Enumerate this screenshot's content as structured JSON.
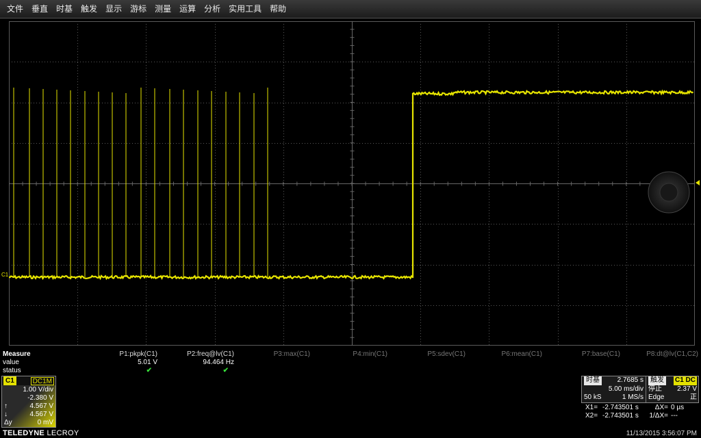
{
  "menu": [
    "文件",
    "垂直",
    "时基",
    "触发",
    "显示",
    "游标",
    "测量",
    "运算",
    "分析",
    "实用工具",
    "帮助"
  ],
  "channel_marker": "C1",
  "measure": {
    "title": "Measure",
    "row_value": "value",
    "row_status": "status",
    "params": [
      {
        "name": "P1:pkpk(C1)",
        "value": "5.01 V",
        "status": "✔",
        "active": true
      },
      {
        "name": "P2:freq@lv(C1)",
        "value": "94.464 Hz",
        "status": "✔",
        "active": true
      },
      {
        "name": "P3:max(C1)",
        "value": "",
        "status": "",
        "active": false
      },
      {
        "name": "P4:min(C1)",
        "value": "",
        "status": "",
        "active": false
      },
      {
        "name": "P5:sdev(C1)",
        "value": "",
        "status": "",
        "active": false
      },
      {
        "name": "P6:mean(C1)",
        "value": "",
        "status": "",
        "active": false
      },
      {
        "name": "P7:base(C1)",
        "value": "",
        "status": "",
        "active": false
      },
      {
        "name": "P8:dt@lv(C1,C2)",
        "value": "",
        "status": "",
        "active": false
      }
    ]
  },
  "c1": {
    "tag": "C1",
    "coupling": "DC1M",
    "vdiv": "1.00 V/div",
    "offset": "-2.380 V",
    "up_label": "↑",
    "up_value": "4.567 V",
    "down_label": "↓",
    "down_value": "4.567 V",
    "dy_label": "Δy",
    "dy_value": "0 mV"
  },
  "brand": {
    "bold": "TELEDYNE",
    "light": "LECROY"
  },
  "timebase": {
    "label": "时基",
    "delay": "2.7685 s",
    "tdiv": "5.00 ms/div",
    "samples": "50 kS",
    "rate": "1 MS/s"
  },
  "trigger": {
    "label": "触发",
    "source": "C1 DC",
    "state": "停止",
    "level": "2.37 V",
    "type": "Edge",
    "slope": "正"
  },
  "cursors": {
    "x1_label": "X1=",
    "x1_value": "-2.743501 s",
    "dx_label": "ΔX=",
    "dx_value": "0 µs",
    "x2_label": "X2=",
    "x2_value": "-2.743501 s",
    "inv_dx_label": "1/ΔX=",
    "inv_dx_value": "---"
  },
  "timestamp": "11/13/2015 3:56:07 PM",
  "colors": {
    "trace": "#e8e600",
    "grid": "#5a5a5a",
    "check": "#37e03a"
  }
}
